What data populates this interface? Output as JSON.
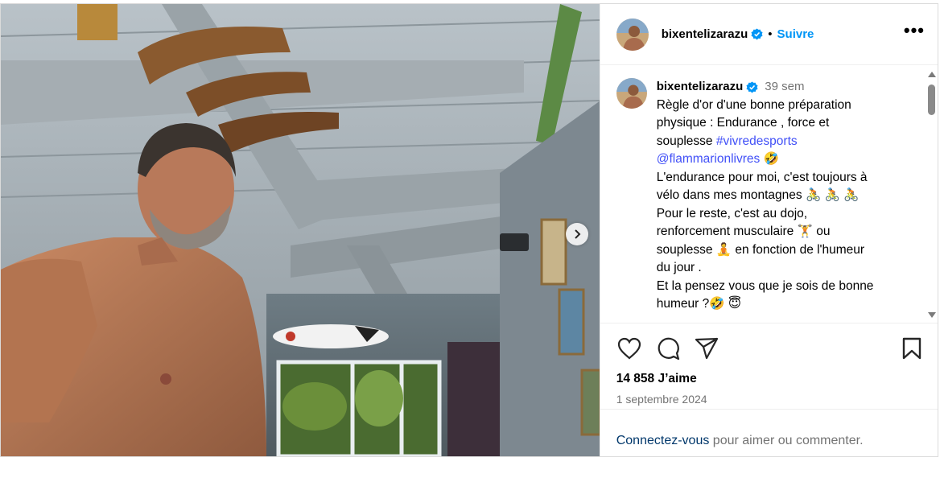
{
  "post": {
    "username": "bixentelizarazu",
    "separator": "•",
    "follow_label": "Suivre",
    "more_label": "•••",
    "time_ago": "39 sem",
    "caption": {
      "line1": "Règle d'or d'une bonne préparation",
      "line2": "physique : Endurance , force et",
      "line3_text": "souplesse ",
      "hashtag": "#vivredesports",
      "mention": "@flammarionlivres",
      "mention_emoji": "🤣",
      "line5": "L'endurance pour moi, c'est toujours à",
      "line6": "vélo dans mes montagnes 🚴 🚴 🚴",
      "line7": "Pour le reste, c'est au dojo,",
      "line8": "renforcement musculaire 🏋 ou",
      "line9": "souplesse 🧘  en fonction de l'humeur",
      "line10": "du jour .",
      "line11": "Et la pensez vous que je sois de bonne",
      "line12": "humeur ?🤣 😇"
    },
    "likes_count": "14 858",
    "likes_label": " J’aime",
    "date": "1 septembre 2024",
    "login_link": "Connectez-vous",
    "login_text": " pour aimer ou commenter."
  },
  "icons": {
    "verified": "verified-badge-icon",
    "like": "heart-icon",
    "comment": "comment-icon",
    "share": "share-icon",
    "save": "bookmark-icon",
    "next": "chevron-right-icon"
  },
  "colors": {
    "accent": "#0095f6",
    "hashtag": "#4150f7",
    "muted": "#737373",
    "link": "#00376b"
  }
}
